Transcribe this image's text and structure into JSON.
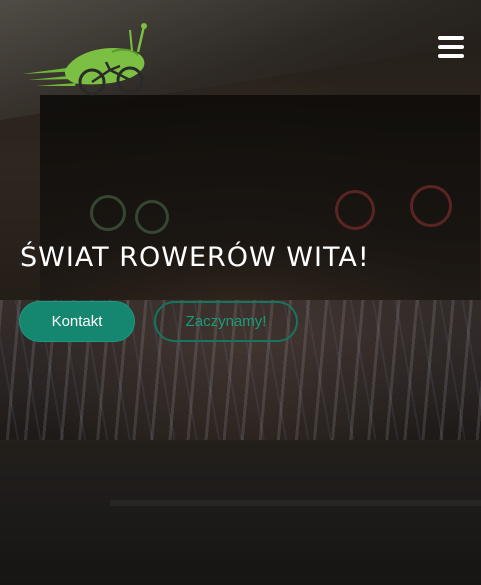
{
  "header": {
    "logo": {
      "icon": "cycling-snail-logo-icon",
      "color": "#7bc043"
    },
    "menu": {
      "icon": "hamburger-menu-icon"
    }
  },
  "hero": {
    "title": "ŚWIAT ROWERÓW WITA!",
    "buttons": {
      "contact_label": "Kontakt",
      "start_label": "Zaczynamy!"
    }
  },
  "colors": {
    "accent": "#15866f",
    "accent_outline": "#1c9a78",
    "text": "#ffffff"
  }
}
